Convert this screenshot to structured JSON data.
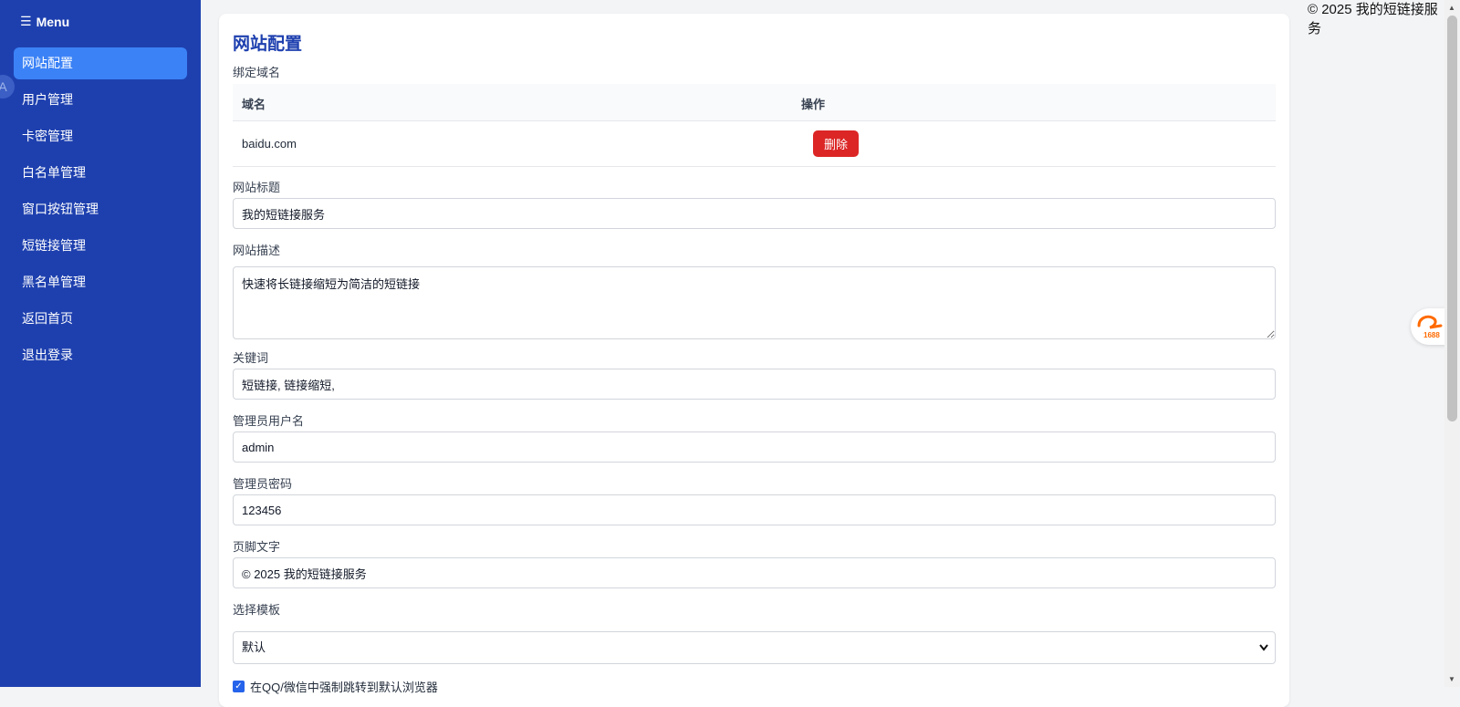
{
  "sidebar": {
    "menu_label": "Menu",
    "items": [
      {
        "label": "网站配置",
        "active": true
      },
      {
        "label": "用户管理"
      },
      {
        "label": "卡密管理"
      },
      {
        "label": "白名单管理"
      },
      {
        "label": "窗口按钮管理"
      },
      {
        "label": "短链接管理"
      },
      {
        "label": "黑名单管理"
      },
      {
        "label": "返回首页"
      },
      {
        "label": "退出登录"
      }
    ],
    "translate_badge": "A"
  },
  "main": {
    "title": "网站配置",
    "domain_section_label": "绑定域名",
    "domain_table": {
      "headers": [
        "域名",
        "操作"
      ],
      "rows": [
        {
          "domain": "baidu.com",
          "action_label": "删除"
        }
      ]
    },
    "fields": {
      "site_title": {
        "label": "网站标题",
        "value": "我的短链接服务"
      },
      "site_desc": {
        "label": "网站描述",
        "value": "快速将长链接缩短为简洁的短链接"
      },
      "keywords": {
        "label": "关键词",
        "value": "短链接, 链接缩短,"
      },
      "admin_user": {
        "label": "管理员用户名",
        "value": "admin"
      },
      "admin_pass": {
        "label": "管理员密码",
        "value": "123456"
      },
      "footer": {
        "label": "页脚文字",
        "value": "© 2025 我的短链接服务"
      },
      "template": {
        "label": "选择模板",
        "value": "默认"
      }
    },
    "force_browser": {
      "label": "在QQ/微信中强制跳转到默认浏览器",
      "checked": true
    }
  },
  "page_footer": "© 2025 我的短链接服务",
  "colors": {
    "sidebar_bg": "#1e40af",
    "active_item": "#3b82f6",
    "delete_button": "#dc2626",
    "title": "#1e40af"
  }
}
